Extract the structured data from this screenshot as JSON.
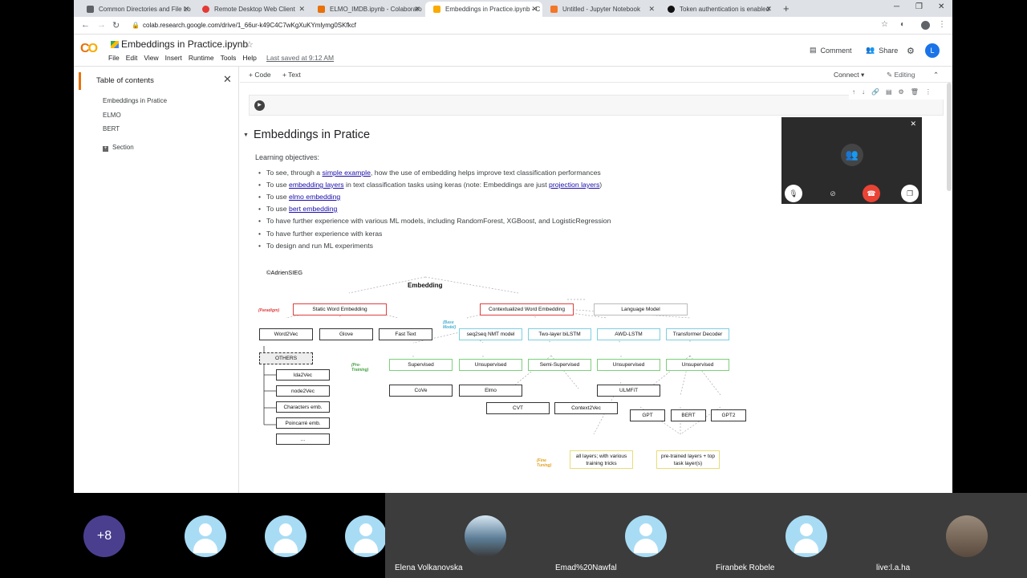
{
  "browser": {
    "tabs": [
      {
        "label": "Common Directories and File Lo",
        "favicon_color": "#5f6368"
      },
      {
        "label": "Remote Desktop Web Client",
        "favicon_color": "#e53935"
      },
      {
        "label": "ELMO_IMDB.ipynb - Colaborato",
        "favicon_color": "#e8710a"
      },
      {
        "label": "Embeddings in Practice.ipynb - C",
        "favicon_color": "#f9ab00"
      },
      {
        "label": "Untitled - Jupyter Notebook",
        "favicon_color": "#f37726"
      },
      {
        "label": "Token authentication is enabled",
        "favicon_color": "#111111"
      }
    ],
    "url": "colab.research.google.com/drive/1_66ur-k49C4C7wKgXuKYmlymg0SKfkcf"
  },
  "colab": {
    "logo_left": "C",
    "logo_right": "O",
    "notebook_title": "Embeddings in Practice.ipynb",
    "menu": [
      "File",
      "Edit",
      "View",
      "Insert",
      "Runtime",
      "Tools",
      "Help"
    ],
    "last_saved": "Last saved at 9:12 AM",
    "comment_label": "Comment",
    "share_label": "Share",
    "profile_initial": "L"
  },
  "toc": {
    "title": "Table of contents",
    "items": [
      "Embeddings in Pratice",
      "ELMO",
      "BERT"
    ],
    "section_label": "Section"
  },
  "toolbar": {
    "code_label": "+ Code",
    "text_label": "+ Text",
    "connect_label": "Connect",
    "editing_label": "Editing"
  },
  "notebook": {
    "heading": "Embeddings in Pratice",
    "learning_objectives": "Learning objectives:",
    "bullets": [
      {
        "pre": "To see, through a ",
        "link": "simple example",
        "post": ", how the use of embedding helps improve text classification performances",
        "link2": "",
        "post2": ""
      },
      {
        "pre": "To use ",
        "link": "embedding layers",
        "post": " in text classification tasks using keras (note: Embeddings are just ",
        "link2": "projection layers",
        "post2": ")"
      },
      {
        "pre": "To use ",
        "link": "elmo embedding",
        "post": "",
        "link2": "",
        "post2": ""
      },
      {
        "pre": "To use ",
        "link": "bert embedding",
        "post": "",
        "link2": "",
        "post2": ""
      },
      {
        "pre": "To have further experience with various ML models, including RandomForest, XGBoost, and LogisticRegression",
        "link": "",
        "post": "",
        "link2": "",
        "post2": ""
      },
      {
        "pre": "To have further experience with keras",
        "link": "",
        "post": "",
        "link2": "",
        "post2": ""
      },
      {
        "pre": "To design and run ML experiments",
        "link": "",
        "post": "",
        "link2": "",
        "post2": ""
      }
    ]
  },
  "diagram": {
    "credit": "©AdrienSIEG",
    "title": "Embedding",
    "paradigm_label": "(Paradigm)",
    "base_model_label": "(Base Model)",
    "pretraining_label": "(Pre-Training)",
    "finetuning_label": "(Fine Tuning)",
    "static": "Static Word Embedding",
    "contextual": "Contextualized Word Embedding",
    "language_model": "Language Model",
    "word2vec": "Word2Vec",
    "glove": "Glove",
    "fasttext": "Fast Text",
    "others": "OTHERS",
    "others_items": [
      "lda2Vec",
      "node2Vec",
      "Characters emb.",
      "Poincarré emb.",
      "..."
    ],
    "base_models": [
      "seq2seq NMT model",
      "Two-layer biLSTM",
      "AWD-LSTM",
      "Transformer Decoder"
    ],
    "pretraining": [
      "Supervised",
      "Unsupervised",
      "Semi-Supervised",
      "Unsupervised",
      "Unsupervised"
    ],
    "cove": "CoVe",
    "elmo": "Elmo",
    "ulmfit": "ULMFiT",
    "cvt": "CVT",
    "context2vec": "Context2Vec",
    "gpt": "GPT",
    "bert": "BERT",
    "gpt2": "GPT2",
    "ft_all": "all layers; with various training tricks",
    "ft_pre": "pre-trained layers + top task layer(s)"
  },
  "participants": [
    {
      "name": "",
      "label": "+8"
    },
    {
      "name": ""
    },
    {
      "name": ""
    },
    {
      "name": ""
    },
    {
      "name": "Elena Volkanovska"
    },
    {
      "name": "Emad%20Nawfal"
    },
    {
      "name": "Firanbek Robele"
    },
    {
      "name": "live:l.a.ha"
    }
  ],
  "colors": {
    "accent_orange": "#e8710a",
    "link": "#1a0dab",
    "brand_blue": "#1a73e8",
    "hangup_red": "#ea4335"
  }
}
